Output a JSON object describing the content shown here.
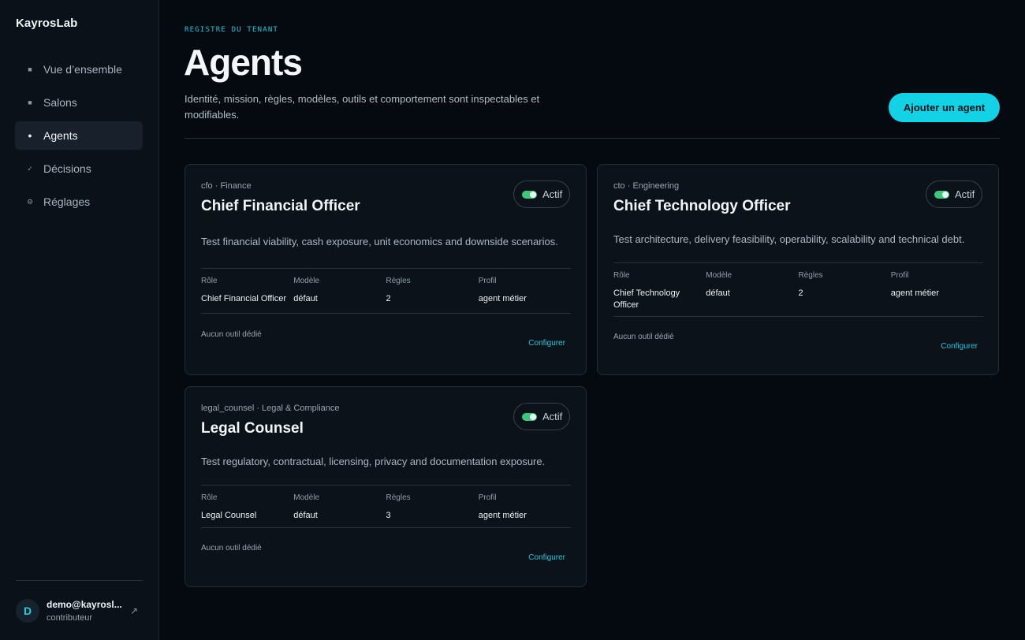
{
  "app": {
    "brand": "KayrosLab"
  },
  "sidebar": {
    "items": [
      {
        "label": "Vue d’ensemble",
        "glyph": "■",
        "active": false
      },
      {
        "label": "Salons",
        "glyph": "■",
        "active": false
      },
      {
        "label": "Agents",
        "glyph": "●",
        "active": true
      },
      {
        "label": "Décisions",
        "glyph": "✓",
        "active": false
      },
      {
        "label": "Réglages",
        "glyph": "⚙",
        "active": false
      }
    ],
    "user": {
      "initial": "D",
      "email": "demo@kayrosl...",
      "role": "contributeur",
      "exit_glyph": "↗"
    }
  },
  "header": {
    "eyebrow": "REGISTRE DU TENANT",
    "title": "Agents",
    "subtitle": "Identité, mission, règles, modèles, outils et comportement sont inspectables et modifiables.",
    "add_button": "Ajouter un agent"
  },
  "fields_labels": {
    "role": "Rôle",
    "model": "Modèle",
    "rules": "Règles",
    "profile": "Profil"
  },
  "agents": [
    {
      "meta": "cfo · Finance",
      "title": "Chief Financial Officer",
      "status": "Actif",
      "description": "Test financial viability, cash exposure, unit economics and downside scenarios.",
      "role": "Chief Financial Officer",
      "model": "défaut",
      "rules": "2",
      "profile": "agent métier",
      "tools": "Aucun outil dédié",
      "configure": "Configurer"
    },
    {
      "meta": "cto · Engineering",
      "title": "Chief Technology Officer",
      "status": "Actif",
      "description": "Test architecture, delivery feasibility, operability, scalability and technical debt.",
      "role": "Chief Technology Officer",
      "model": "défaut",
      "rules": "2",
      "profile": "agent métier",
      "tools": "Aucun outil dédié",
      "configure": "Configurer"
    },
    {
      "meta": "legal_counsel · Legal & Compliance",
      "title": "Legal Counsel",
      "status": "Actif",
      "description": "Test regulatory, contractual, licensing, privacy and documentation exposure.",
      "role": "Legal Counsel",
      "model": "défaut",
      "rules": "3",
      "profile": "agent métier",
      "tools": "Aucun outil dédié",
      "configure": "Configurer"
    }
  ],
  "colors": {
    "accent": "#14d2e6",
    "toggle_on": "#3ec77a",
    "background": "#050a11"
  }
}
